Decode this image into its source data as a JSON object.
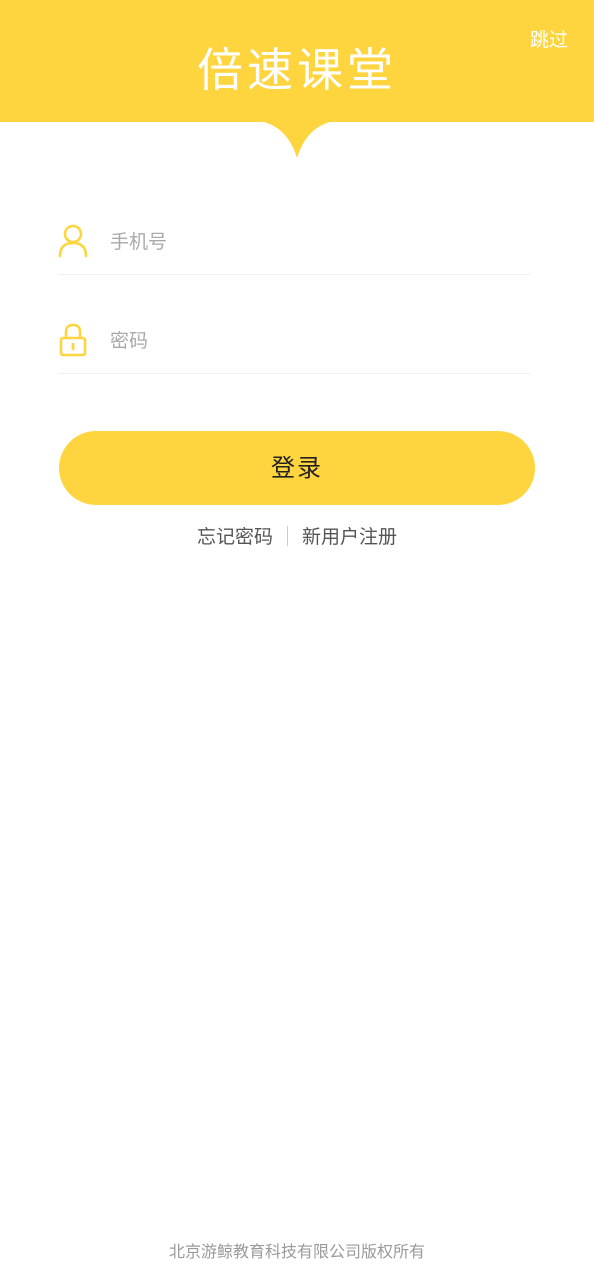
{
  "header": {
    "app_title": "倍速课堂",
    "skip_label": "跳过"
  },
  "form": {
    "phone": {
      "icon": "user-icon",
      "placeholder": "手机号",
      "value": ""
    },
    "password": {
      "icon": "lock-icon",
      "placeholder": "密码",
      "value": ""
    },
    "login_label": "登录"
  },
  "links": {
    "forgot_password": "忘记密码",
    "register": "新用户注册"
  },
  "footer": {
    "copyright": "北京游鲸教育科技有限公司版权所有"
  },
  "colors": {
    "brand": "#FFD53F",
    "placeholder": "#A9A9A9",
    "footer_text": "#9A9A9A"
  }
}
